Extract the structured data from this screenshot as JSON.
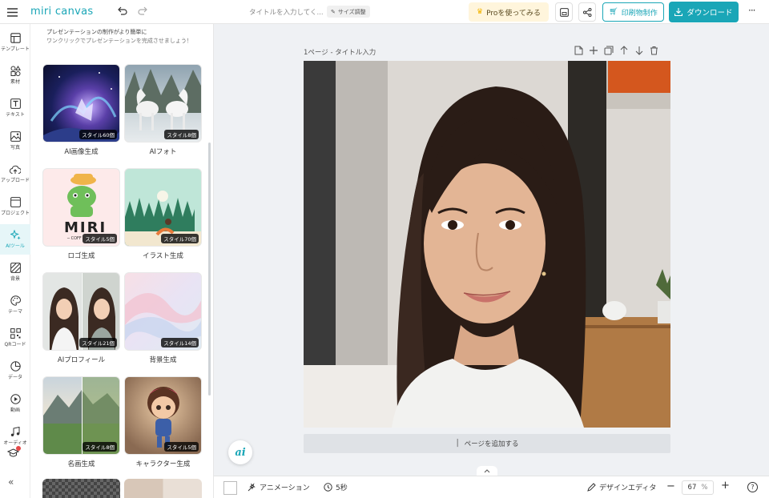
{
  "app": {
    "logo": "miri canvas",
    "title_placeholder": "タイトルを入力してく...",
    "size_label": "サイズ調整"
  },
  "header": {
    "pro_label": "Proを使ってみる",
    "print_label": "印刷物制作",
    "download_label": "ダウンロード"
  },
  "sidebar": {
    "items": [
      {
        "label": "テンプレート",
        "icon": "template-icon"
      },
      {
        "label": "素材",
        "icon": "elements-icon"
      },
      {
        "label": "テキスト",
        "icon": "text-icon"
      },
      {
        "label": "写真",
        "icon": "photo-icon"
      },
      {
        "label": "アップロード",
        "icon": "upload-icon"
      },
      {
        "label": "プロジェクト",
        "icon": "project-icon"
      },
      {
        "label": "AIツール",
        "icon": "ai-tool-icon"
      },
      {
        "label": "背景",
        "icon": "background-icon"
      },
      {
        "label": "テーマ",
        "icon": "theme-icon"
      },
      {
        "label": "QRコード",
        "icon": "qr-icon"
      },
      {
        "label": "データ",
        "icon": "data-icon"
      },
      {
        "label": "動画",
        "icon": "video-icon"
      },
      {
        "label": "オーディオ",
        "icon": "audio-icon"
      }
    ]
  },
  "panel": {
    "intro_line1": "プレゼンテーションの制作がより簡単に",
    "intro_line2": "ワンクリックでプレゼンテーションを完成させましょう！",
    "cards": [
      {
        "label": "AI画像生成",
        "badge": "スタイル60個"
      },
      {
        "label": "AIフォト",
        "badge": "スタイル8個"
      },
      {
        "label": "ロゴ生成",
        "badge": "スタイル5個"
      },
      {
        "label": "イラスト生成",
        "badge": "スタイル70個"
      },
      {
        "label": "AIプロフィール",
        "badge": "スタイル21個"
      },
      {
        "label": "背景生成",
        "badge": "スタイル14個"
      },
      {
        "label": "名画生成",
        "badge": "スタイル8個"
      },
      {
        "label": "キャラクター生成",
        "badge": "スタイル5個"
      }
    ],
    "logo_text": "MIRI",
    "logo_sub": "─ COFF"
  },
  "canvas": {
    "page_label": "1ページ - タイトル入力",
    "add_page_label": "ページを追加する",
    "ai_badge": "ai"
  },
  "bottom": {
    "animation_label": "アニメーション",
    "duration_label": "5秒",
    "design_editor_label": "デザインエディタ",
    "zoom_value": "67",
    "zoom_unit": "%"
  },
  "colors": {
    "accent": "#1aa6b7",
    "pro_bg": "#fff5dc",
    "pro_text": "#8a6a1a"
  }
}
